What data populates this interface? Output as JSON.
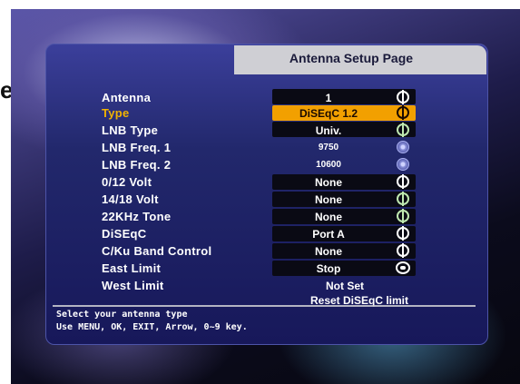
{
  "page": {
    "edge_glyph": "e",
    "title": "Antenna Setup Page"
  },
  "rows": [
    {
      "label": "Antenna",
      "value": "1",
      "icon": "phi-icon",
      "active": false
    },
    {
      "label": "Type",
      "value": "DiSEqC 1.2",
      "icon": "phi-icon",
      "active": true
    },
    {
      "label": "LNB Type",
      "value": "Univ.",
      "icon": "phi-icon",
      "active": false
    },
    {
      "label": "LNB Freq. 1",
      "value": "9750",
      "icon": "dial-icon",
      "active": false
    },
    {
      "label": "LNB Freq. 2",
      "value": "10600",
      "icon": "dial-icon",
      "active": false
    },
    {
      "label": "0/12 Volt",
      "value": "None",
      "icon": "phi-icon",
      "active": false
    },
    {
      "label": "14/18 Volt",
      "value": "None",
      "icon": "phi-icon",
      "active": false
    },
    {
      "label": "22KHz Tone",
      "value": "None",
      "icon": "phi-icon",
      "active": false
    },
    {
      "label": "DiSEqC",
      "value": "Port A",
      "icon": "phi-icon",
      "active": false
    },
    {
      "label": "C/Ku Band Control",
      "value": "None",
      "icon": "phi-icon",
      "active": false
    },
    {
      "label": "East Limit",
      "value": "Stop",
      "icon": "knob-icon",
      "active": false
    },
    {
      "label": "West Limit",
      "value": "Not Set",
      "icon": "",
      "active": false
    }
  ],
  "reset_label": "Reset DiSEqC limit",
  "help": {
    "line1": "Select your antenna type",
    "line2": "Use MENU, OK, EXIT, Arrow, 0~9 key."
  },
  "colors": {
    "highlight": "#f2a000",
    "panel": "#22286c",
    "title_bar": "#cfcfd4"
  }
}
